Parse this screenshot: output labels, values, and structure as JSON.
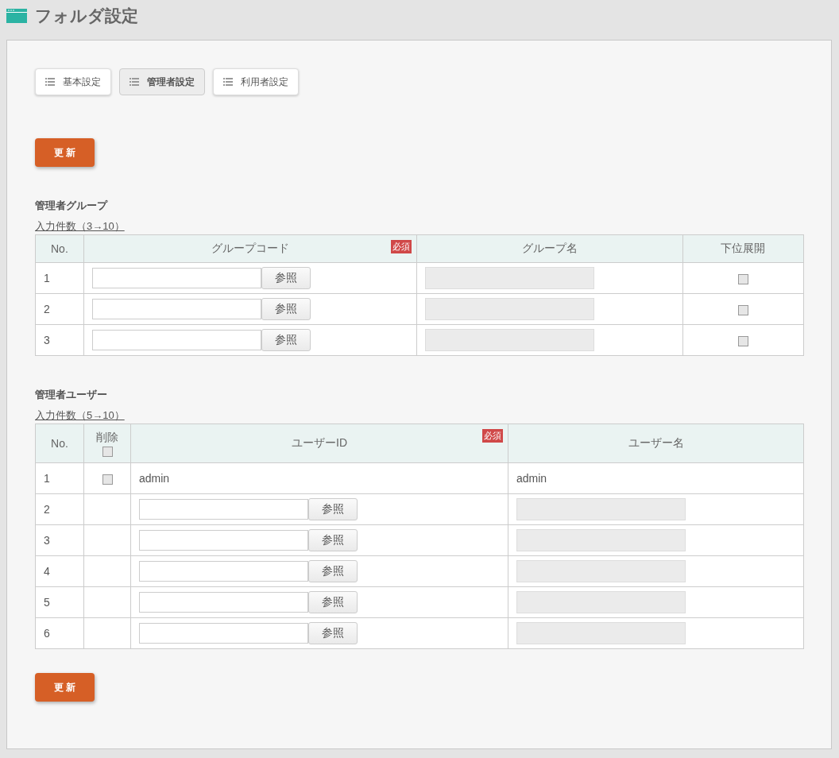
{
  "page": {
    "title": "フォルダ設定"
  },
  "tabs": [
    {
      "label": "基本設定",
      "selected": false
    },
    {
      "label": "管理者設定",
      "selected": true
    },
    {
      "label": "利用者設定",
      "selected": false
    }
  ],
  "update_button_top": "更 新",
  "admin_groups": {
    "title": "管理者グループ",
    "count_link": "入力件数（3→10）",
    "columns": [
      {
        "label": "No."
      },
      {
        "label": "グループコード",
        "required": "必須"
      },
      {
        "label": "グループ名"
      },
      {
        "label": "下位展開"
      }
    ],
    "rows": [
      {
        "no": "1",
        "button": "参照",
        "checked": false
      },
      {
        "no": "2",
        "button": "参照",
        "checked": false
      },
      {
        "no": "3",
        "button": "参照",
        "checked": false
      }
    ]
  },
  "admin_users": {
    "title": "管理者ユーザー",
    "count_link": "入力件数（5→10）",
    "columns": [
      {
        "label": "No."
      },
      {
        "label": "削除",
        "checked": false
      },
      {
        "label": "ユーザーID",
        "required": "必須"
      },
      {
        "label": "ユーザー名"
      }
    ],
    "rows": [
      {
        "no": "1",
        "kind": "fixed",
        "delete_checked": false,
        "user_id": "admin",
        "user_name": "admin"
      },
      {
        "no": "2",
        "kind": "input",
        "button": "参照"
      },
      {
        "no": "3",
        "kind": "input",
        "button": "参照"
      },
      {
        "no": "4",
        "kind": "input",
        "button": "参照"
      },
      {
        "no": "5",
        "kind": "input",
        "button": "参照"
      },
      {
        "no": "6",
        "kind": "input",
        "button": "参照"
      }
    ]
  },
  "update_button_bottom": "更 新"
}
